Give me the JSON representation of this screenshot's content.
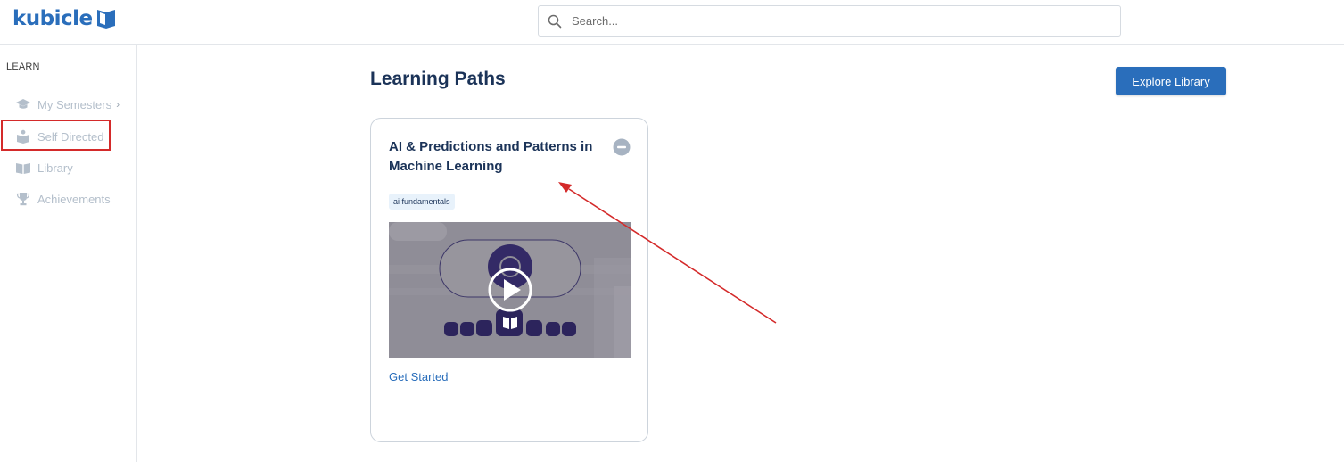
{
  "app": {
    "logo_text": "kubicle"
  },
  "search": {
    "placeholder": "Search..."
  },
  "sidebar": {
    "section_label": "LEARN",
    "items": [
      {
        "label": "My Semesters",
        "icon": "graduation-cap-icon",
        "has_chevron": true,
        "chevron": "›"
      },
      {
        "label": "Self Directed",
        "icon": "reader-icon",
        "highlighted": true
      },
      {
        "label": "Library",
        "icon": "open-book-icon"
      },
      {
        "label": "Achievements",
        "icon": "trophy-icon"
      }
    ]
  },
  "main": {
    "title": "Learning Paths",
    "explore_button": "Explore Library",
    "cards": [
      {
        "title": "AI & Predictions and Patterns in Machine Learning",
        "tag": "ai fundamentals",
        "cta": "Get Started",
        "thumbnail_icon": "play-icon"
      }
    ]
  },
  "colors": {
    "brand": "#2a6ebb",
    "heading": "#1b3358",
    "sidebar_muted": "#b4bfcb",
    "annotation": "#d42a2a"
  }
}
